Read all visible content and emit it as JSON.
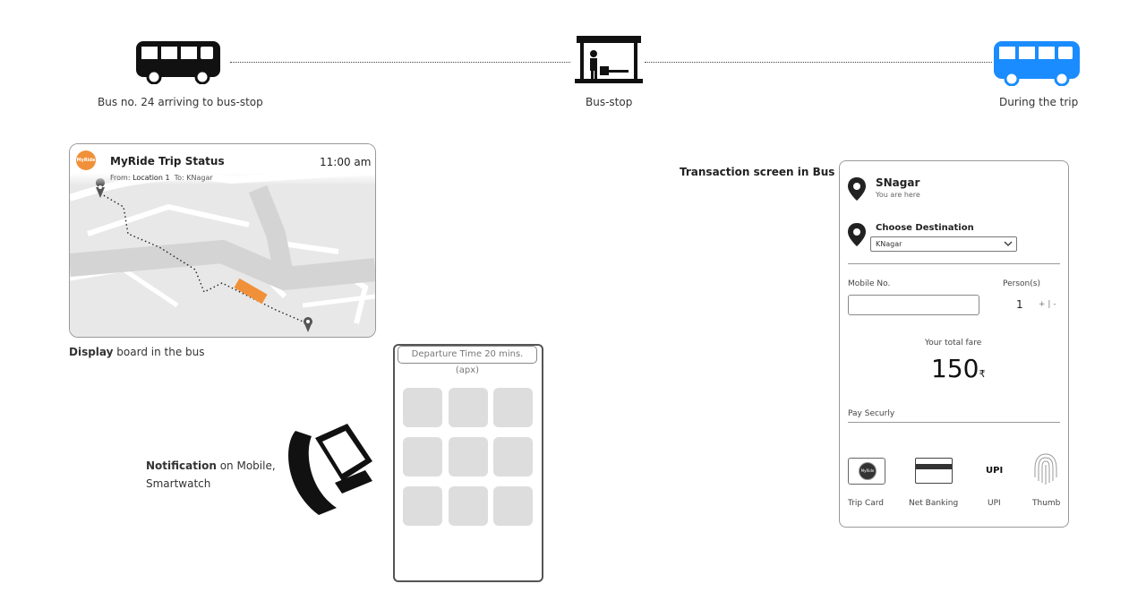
{
  "timeline": {
    "bus_arriving_label": "Bus no. 24 arriving to bus-stop",
    "bus_stop_label": "Bus-stop",
    "during_trip_label": "During the trip"
  },
  "display_board": {
    "logo_text": "MyRide",
    "title": "MyRide Trip Status",
    "time": "11:00 am",
    "from_prefix": "From:",
    "from_value": "Location 1",
    "to_prefix": "To:",
    "to_value": "KNagar",
    "caption_bold": "Display",
    "caption_rest": " board in the bus"
  },
  "notification": {
    "caption_bold": "Notification",
    "caption_rest": " on Mobile,",
    "caption_line2": "Smartwatch"
  },
  "phone": {
    "pill_text": "Departure Time 20 mins. (apx)"
  },
  "transaction": {
    "section_label": "Transaction screen in Bus",
    "current_stop": "SNagar",
    "current_sub": "You are here",
    "choose_label": "Choose Destination",
    "destination_value": "KNagar",
    "mobile_label": "Mobile No.",
    "persons_label": "Person(s)",
    "persons_value": "1",
    "plus": "+",
    "separator": "|",
    "minus": "-",
    "fare_label": "Your total fare",
    "fare_value": "150",
    "currency": "₹",
    "pay_label": "Pay Securly",
    "pay_options": [
      "Trip Card",
      "Net Banking",
      "UPI",
      "Thumb"
    ],
    "upi_mark": "UPI",
    "card_logo_text": "MyRide"
  },
  "colors": {
    "bus_black": "#111111",
    "bus_blue": "#1a8cff",
    "accent_orange": "#f0913a",
    "tile_gray": "#dddddd"
  }
}
